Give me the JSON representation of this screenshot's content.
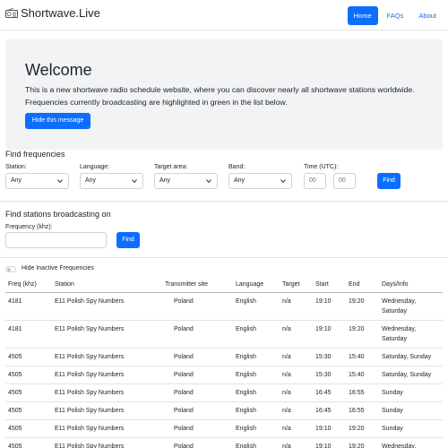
{
  "navbar": {
    "brand": "Shortwave.Live",
    "brand_icon": "radio-icon",
    "links": [
      {
        "label": "Home",
        "active": true
      },
      {
        "label": "FAQs",
        "active": false
      },
      {
        "label": "About",
        "active": false
      }
    ],
    "accent": "#0d6efd"
  },
  "welcome": {
    "title": "Welcome",
    "text": "This is a new shortwave radio schedule website, where you can discover nearly all shortwave stations worldwide. Frequencies currently broadcasting are highlighted in green in the list below.",
    "hide_button": "Hide this message"
  },
  "find_frequencies": {
    "title": "Find frequencies",
    "station_label": "Station:",
    "station_value": "Any",
    "language_label": "Language:",
    "language_value": "Any",
    "target_label": "Target area:",
    "target_value": "Any",
    "band_label": "Band:",
    "band_value": "Any",
    "time_label": "Time (UTC):",
    "hour_placeholder": "00",
    "minute_placeholder": "00",
    "find_button": "Find"
  },
  "find_stations": {
    "title": "Find stations broadcasting on",
    "freq_label": "Frequency (khz):",
    "freq_value": "",
    "find_button": "Find"
  },
  "toggle": {
    "label": "Hide Inactive Frequencies",
    "checked": false
  },
  "table": {
    "headers": [
      "Freq (khz)",
      "Station",
      "Transmitter site",
      "Language",
      "Target",
      "Start",
      "End",
      "Days/Info"
    ],
    "rows": [
      [
        "4181",
        "E11 Polish Spy Numbers",
        "Poland",
        "English",
        "n/a",
        "19:10",
        "19:20",
        "Wednesday, Saturday"
      ],
      [
        "4181",
        "E11 Polish Spy Numbers",
        "Poland",
        "English",
        "n/a",
        "19:10",
        "19:20",
        "Wednesday, Saturday"
      ],
      [
        "4505",
        "E11 Polish Spy Numbers",
        "Poland",
        "English",
        "n/a",
        "15:30",
        "15:40",
        "Saturday, Sunday"
      ],
      [
        "4505",
        "E11 Polish Spy Numbers",
        "Poland",
        "English",
        "n/a",
        "15:30",
        "15:40",
        "Saturday, Sunday"
      ],
      [
        "4505",
        "E11 Polish Spy Numbers",
        "Poland",
        "English",
        "n/a",
        "16:45",
        "16:55",
        "Sunday"
      ],
      [
        "4505",
        "E11 Polish Spy Numbers",
        "Poland",
        "English",
        "n/a",
        "16:45",
        "16:55",
        "Sunday"
      ],
      [
        "4505",
        "E11 Polish Spy Numbers",
        "Poland",
        "English",
        "n/a",
        "19:10",
        "19:20",
        "Sunday"
      ],
      [
        "4505",
        "E11 Polish Spy Numbers",
        "Poland",
        "English",
        "n/a",
        "19:10",
        "19:20",
        "Wednesday, Saturday"
      ]
    ]
  }
}
